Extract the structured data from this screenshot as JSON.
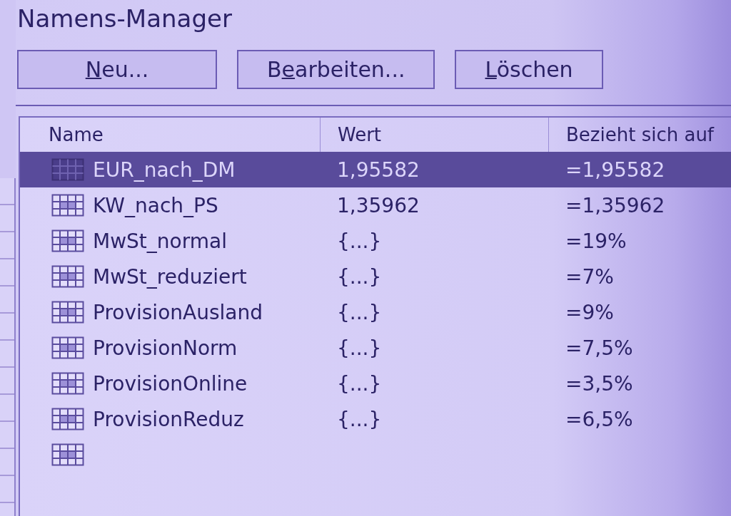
{
  "window": {
    "title": "Namens-Manager"
  },
  "buttons": [
    {
      "access_key": "N",
      "rest": "eu..."
    },
    {
      "lead": "B",
      "access_key": "e",
      "rest": "arbeiten..."
    },
    {
      "access_key": "L",
      "rest": "öschen"
    }
  ],
  "table": {
    "columns": [
      "Name",
      "Wert",
      "Bezieht sich auf"
    ],
    "rows": [
      {
        "name": "EUR_nach_DM",
        "value": "1,95582",
        "refers_to": "=1,95582",
        "selected": true
      },
      {
        "name": "KW_nach_PS",
        "value": "1,35962",
        "refers_to": "=1,35962",
        "selected": false
      },
      {
        "name": "MwSt_normal",
        "value": "{...}",
        "refers_to": "=19%",
        "selected": false
      },
      {
        "name": "MwSt_reduziert",
        "value": "{...}",
        "refers_to": "=7%",
        "selected": false
      },
      {
        "name": "ProvisionAusland",
        "value": "{...}",
        "refers_to": "=9%",
        "selected": false
      },
      {
        "name": "ProvisionNorm",
        "value": "{...}",
        "refers_to": "=7,5%",
        "selected": false
      },
      {
        "name": "ProvisionOnline",
        "value": "{...}",
        "refers_to": "=3,5%",
        "selected": false
      },
      {
        "name": "ProvisionReduz",
        "value": "{...}",
        "refers_to": "=6,5%",
        "selected": false
      },
      {
        "selected": false
      }
    ]
  }
}
